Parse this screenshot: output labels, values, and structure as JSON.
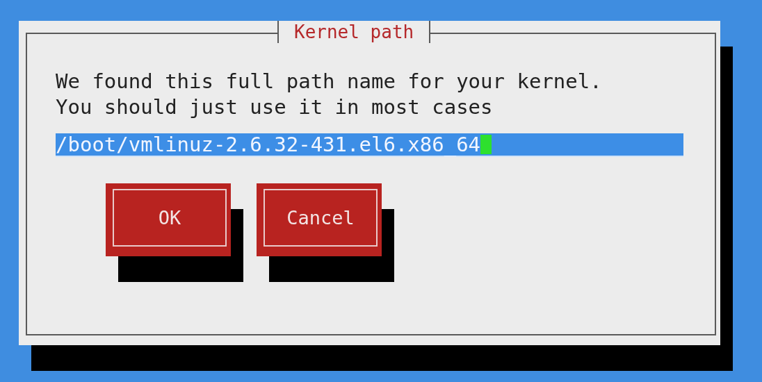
{
  "dialog": {
    "title": "Kernel path",
    "message_lines": [
      "We found this full path name for your kernel.",
      "You should just use it in most cases"
    ],
    "input": {
      "value": "/boot/vmlinuz-2.6.32-431.el6.x86_64",
      "focused": true
    },
    "buttons": [
      {
        "label": "OK"
      },
      {
        "label": "Cancel"
      }
    ]
  }
}
